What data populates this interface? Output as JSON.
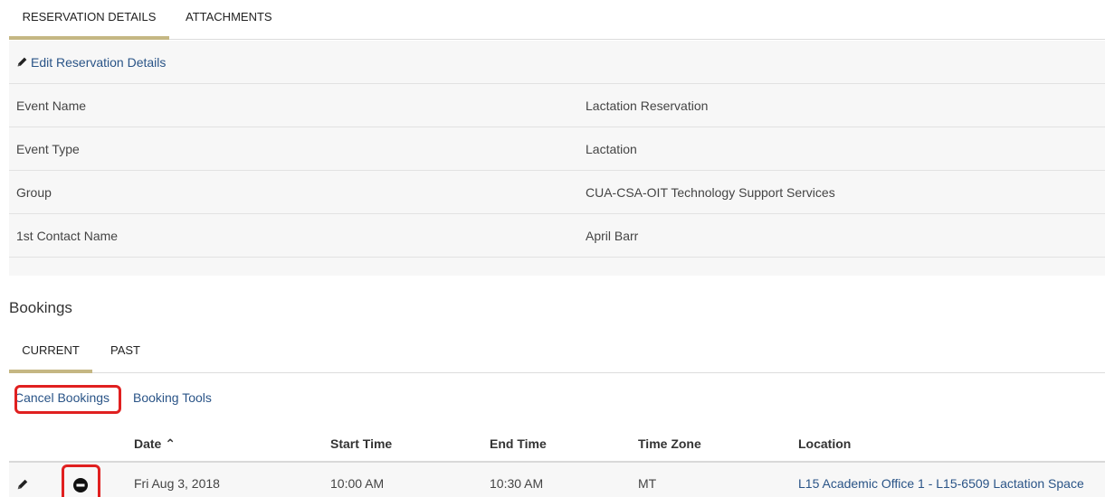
{
  "tabs": [
    {
      "label": "RESERVATION DETAILS",
      "active": true
    },
    {
      "label": "ATTACHMENTS",
      "active": false
    }
  ],
  "details": {
    "edit_label": "Edit Reservation Details",
    "rows": [
      {
        "label": "Event Name",
        "value": "Lactation Reservation"
      },
      {
        "label": "Event Type",
        "value": "Lactation"
      },
      {
        "label": "Group",
        "value": "CUA-CSA-OIT Technology Support Services"
      },
      {
        "label": "1st Contact Name",
        "value": "April Barr"
      }
    ]
  },
  "bookings": {
    "title": "Bookings",
    "tabs": [
      {
        "label": "CURRENT",
        "active": true
      },
      {
        "label": "PAST",
        "active": false
      }
    ],
    "tools": {
      "cancel_label": "Cancel Bookings",
      "booking_tools_label": "Booking Tools"
    },
    "columns": {
      "date": "Date ⌃",
      "start": "Start Time",
      "end": "End Time",
      "timezone": "Time Zone",
      "location": "Location"
    },
    "rows": [
      {
        "date": "Fri Aug 3, 2018",
        "start": "10:00 AM",
        "end": "10:30 AM",
        "timezone": "MT",
        "location": "L15 Academic Office 1 - L15-6509 Lactation Space"
      }
    ]
  },
  "icons": {
    "edit": "pencil-icon",
    "cancel_booking": "minus-circle-icon",
    "sort": "sort-ascending-icon"
  },
  "colors": {
    "accent": "#c5b783",
    "link": "#2a5487",
    "highlight": "#e02020",
    "panel_bg": "#f7f7f7"
  }
}
